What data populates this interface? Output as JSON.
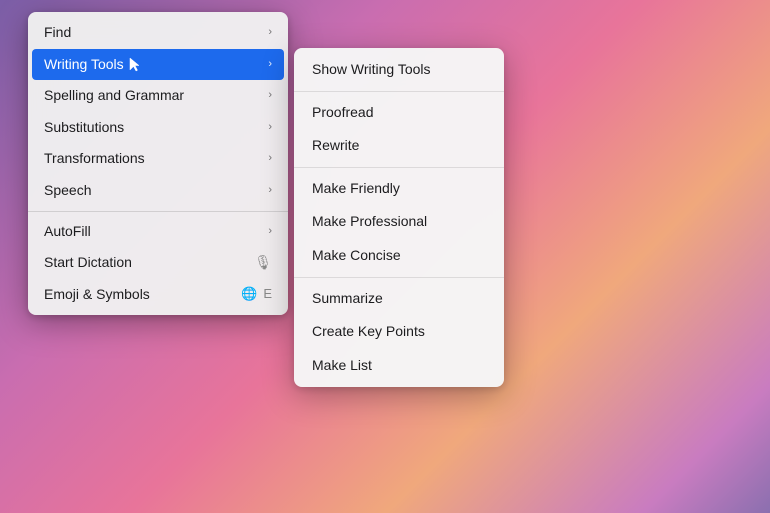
{
  "background": {
    "description": "macOS desktop gradient background"
  },
  "main_menu": {
    "items": [
      {
        "id": "find",
        "label": "Find",
        "has_submenu": true,
        "highlighted": false,
        "shortcut": null
      },
      {
        "id": "writing-tools",
        "label": "Writing Tools",
        "has_submenu": true,
        "highlighted": true,
        "shortcut": null
      },
      {
        "id": "spelling-grammar",
        "label": "Spelling and Grammar",
        "has_submenu": true,
        "highlighted": false,
        "shortcut": null
      },
      {
        "id": "substitutions",
        "label": "Substitutions",
        "has_submenu": true,
        "highlighted": false,
        "shortcut": null
      },
      {
        "id": "transformations",
        "label": "Transformations",
        "has_submenu": true,
        "highlighted": false,
        "shortcut": null
      },
      {
        "id": "speech",
        "label": "Speech",
        "has_submenu": true,
        "highlighted": false,
        "shortcut": null
      },
      {
        "separator": true
      },
      {
        "id": "autofill",
        "label": "AutoFill",
        "has_submenu": true,
        "highlighted": false,
        "shortcut": null
      },
      {
        "id": "start-dictation",
        "label": "Start Dictation",
        "has_submenu": false,
        "highlighted": false,
        "shortcut": "mic"
      },
      {
        "id": "emoji-symbols",
        "label": "Emoji & Symbols",
        "has_submenu": false,
        "highlighted": false,
        "shortcut": "globe-e"
      }
    ]
  },
  "submenu": {
    "items": [
      {
        "id": "show-writing-tools",
        "label": "Show Writing Tools",
        "has_separator_after": true
      },
      {
        "id": "proofread",
        "label": "Proofread"
      },
      {
        "id": "rewrite",
        "label": "Rewrite",
        "has_separator_after": true
      },
      {
        "id": "make-friendly",
        "label": "Make Friendly"
      },
      {
        "id": "make-professional",
        "label": "Make Professional"
      },
      {
        "id": "make-concise",
        "label": "Make Concise",
        "has_separator_after": true
      },
      {
        "id": "summarize",
        "label": "Summarize"
      },
      {
        "id": "create-key-points",
        "label": "Create Key Points"
      },
      {
        "id": "make-list",
        "label": "Make List"
      }
    ]
  }
}
